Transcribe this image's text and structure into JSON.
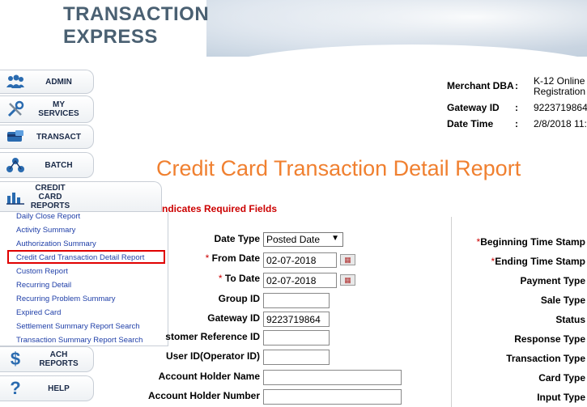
{
  "header": {
    "logo_line1": "TRANSACTION",
    "logo_line2": "EXPRESS"
  },
  "nav": {
    "admin": "ADMIN",
    "my_services_1": "MY",
    "my_services_2": "SERVICES",
    "transact": "TRANSACT",
    "batch": "BATCH",
    "cc_reports_1": "CREDIT",
    "cc_reports_2": "CARD",
    "cc_reports_3": "REPORTS",
    "ach_reports_1": "ACH",
    "ach_reports_2": "REPORTS",
    "help": "HELP"
  },
  "report_links": [
    "Daily Close Report",
    "Activity Summary",
    "Authorization Summary",
    "Credit Card Transaction Detail Report",
    "Custom Report",
    "Recurring Detail",
    "Recurring Problem Summary",
    "Expired Card",
    "Settlement Summary Report Search",
    "Transaction Summary Report Search"
  ],
  "merchant": {
    "dba_label": "Merchant DBA",
    "dba_value_1": "K-12 Online",
    "dba_value_2": "Registration",
    "gateway_label": "Gateway ID",
    "gateway_value": "9223719864",
    "date_label": "Date Time",
    "date_value": "2/8/2018 11:",
    "colon": ":"
  },
  "page": {
    "title": "Credit Card Transaction Detail Report",
    "required_note": "ndicates Required Fields"
  },
  "form": {
    "date_type_label": "Date Type",
    "date_type_value": "Posted Date",
    "from_date_label": "From Date",
    "from_date_value": "02-07-2018",
    "to_date_label": "To Date",
    "to_date_value": "02-07-2018",
    "group_id_label": "Group ID",
    "group_id_value": "",
    "gateway_id_label": "Gateway ID",
    "gateway_id_value": "9223719864",
    "customer_ref_label": "stomer Reference ID",
    "customer_ref_value": "",
    "user_id_label": "User ID(Operator ID)",
    "user_id_value": "",
    "holder_name_label": "Account Holder Name",
    "holder_name_value": "",
    "holder_number_label": "Account Holder Number",
    "holder_number_value": "",
    "required_star": "*"
  },
  "right_fields": {
    "begin_time": "Beginning Time Stamp",
    "end_time": "Ending Time Stamp",
    "payment_type": "Payment Type",
    "sale_type": "Sale Type",
    "status": "Status",
    "response_type": "Response Type",
    "transaction_type": "Transaction Type",
    "card_type": "Card Type",
    "input_type": "Input Type"
  },
  "colors": {
    "title": "#f08030",
    "required": "#cc0000",
    "link": "#1f3fa8",
    "highlight": "#e00000"
  }
}
